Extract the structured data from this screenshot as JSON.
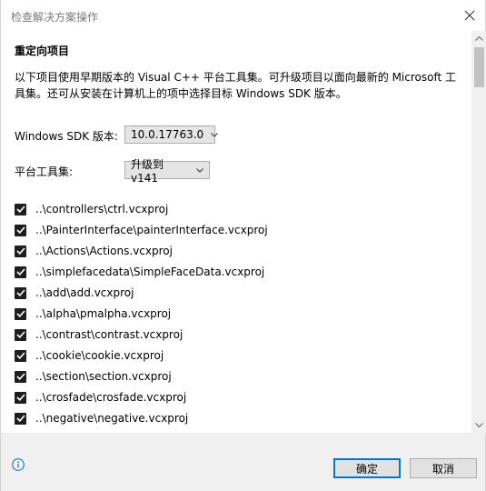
{
  "window": {
    "title": "检查解决方案操作"
  },
  "section": {
    "heading": "重定向项目",
    "description": "以下项目使用早期版本的 Visual C++ 平台工具集。可升级项目以面向最新的 Microsoft 工具集。还可从安装在计算机上的项中选择目标 Windows SDK 版本。"
  },
  "sdk": {
    "label": "Windows SDK 版本:",
    "value": "10.0.17763.0"
  },
  "toolset": {
    "label": "平台工具集:",
    "value": "升级到 v141"
  },
  "projects": [
    {
      "name": "..\\controllers\\ctrl.vcxproj",
      "checked": true
    },
    {
      "name": "..\\PainterInterface\\painterInterface.vcxproj",
      "checked": true
    },
    {
      "name": "..\\Actions\\Actions.vcxproj",
      "checked": true
    },
    {
      "name": "..\\simplefacedata\\SimpleFaceData.vcxproj",
      "checked": true
    },
    {
      "name": "..\\add\\add.vcxproj",
      "checked": true
    },
    {
      "name": "..\\alpha\\pmalpha.vcxproj",
      "checked": true
    },
    {
      "name": "..\\contrast\\contrast.vcxproj",
      "checked": true
    },
    {
      "name": "..\\cookie\\cookie.vcxproj",
      "checked": true
    },
    {
      "name": "..\\section\\section.vcxproj",
      "checked": true
    },
    {
      "name": "..\\crosfade\\crosfade.vcxproj",
      "checked": true
    },
    {
      "name": "..\\negative\\negative.vcxproj",
      "checked": true
    }
  ],
  "buttons": {
    "ok": "确定",
    "cancel": "取消"
  },
  "colors": {
    "accent": "#0078d7",
    "footer": "#f0f0f0",
    "checkbox": "#1e1e1e"
  }
}
